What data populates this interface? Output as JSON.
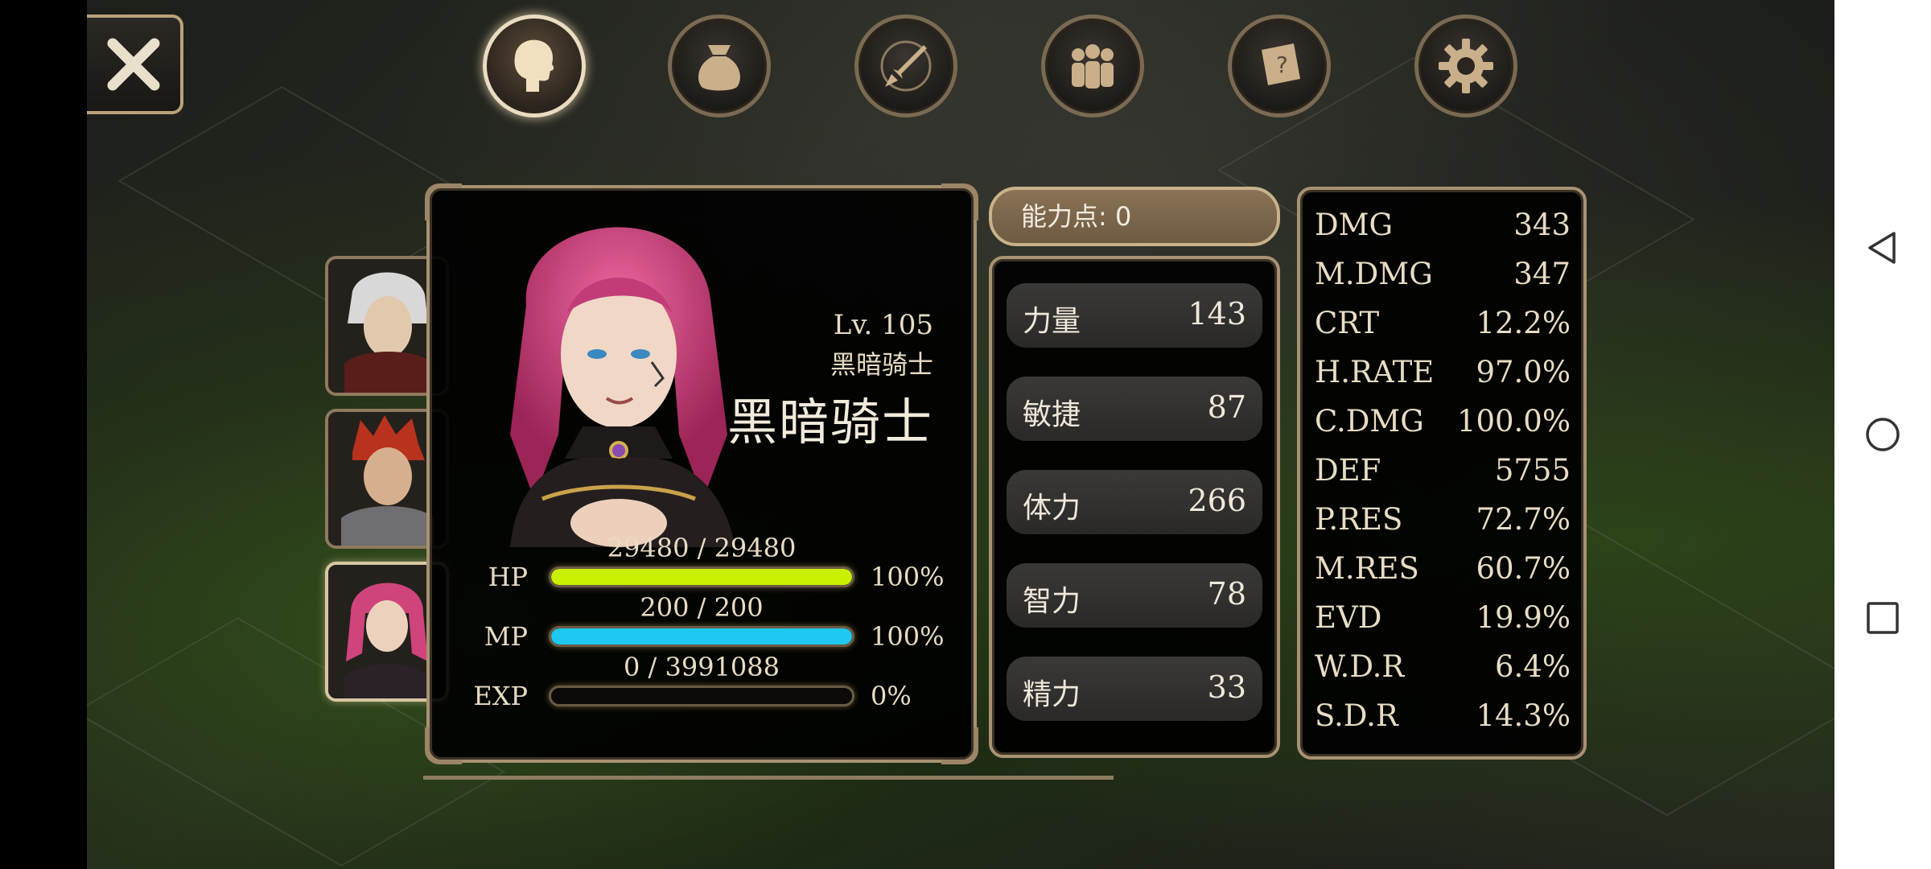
{
  "top_bar": {
    "close_icon": "close-x-icon",
    "tabs": [
      {
        "name": "character-tab",
        "icon": "head-silhouette-icon",
        "active": true
      },
      {
        "name": "inventory-tab",
        "icon": "bag-icon",
        "active": false
      },
      {
        "name": "skills-tab",
        "icon": "sword-compass-icon",
        "active": false
      },
      {
        "name": "party-tab",
        "icon": "group-icon",
        "active": false
      },
      {
        "name": "quest-tab",
        "icon": "scroll-question-icon",
        "active": false
      },
      {
        "name": "settings-tab",
        "icon": "gear-icon",
        "active": false
      }
    ]
  },
  "party_portraits": [
    {
      "name": "white-hair-hero",
      "active": false
    },
    {
      "name": "red-hair-hero",
      "active": false
    },
    {
      "name": "pink-hair-hero",
      "active": true
    }
  ],
  "character": {
    "level": "Lv. 105",
    "class_small": "黑暗骑士",
    "class_big": "黑暗骑士",
    "hp_value": "29480 / 29480",
    "hp_label": "HP",
    "hp_pct": "100%",
    "hp_fill": 1.0,
    "mp_value": "200 / 200",
    "mp_label": "MP",
    "mp_pct": "100%",
    "mp_fill": 1.0,
    "exp_value": "0 / 3991088",
    "exp_label": "EXP",
    "exp_pct": "0%",
    "exp_fill": 0.0
  },
  "ability_points": "能力点: 0",
  "attributes": [
    {
      "label": "力量",
      "value": "143"
    },
    {
      "label": "敏捷",
      "value": "87"
    },
    {
      "label": "体力",
      "value": "266"
    },
    {
      "label": "智力",
      "value": "78"
    },
    {
      "label": "精力",
      "value": "33"
    }
  ],
  "stats": [
    {
      "label": "DMG",
      "value": "343"
    },
    {
      "label": "M.DMG",
      "value": "347"
    },
    {
      "label": "CRT",
      "value": "12.2%"
    },
    {
      "label": "H.RATE",
      "value": "97.0%"
    },
    {
      "label": "C.DMG",
      "value": "100.0%"
    },
    {
      "label": "DEF",
      "value": "5755"
    },
    {
      "label": "P.RES",
      "value": "72.7%"
    },
    {
      "label": "M.RES",
      "value": "60.7%"
    },
    {
      "label": "EVD",
      "value": "19.9%"
    },
    {
      "label": "W.D.R",
      "value": "6.4%"
    },
    {
      "label": "S.D.R",
      "value": "14.3%"
    }
  ],
  "colors": {
    "hp_bar": "#c8f000",
    "mp_bar": "#1ec8f0",
    "frame_gold": "#a89272"
  },
  "android_nav": [
    "back-icon",
    "home-icon",
    "recents-icon"
  ]
}
